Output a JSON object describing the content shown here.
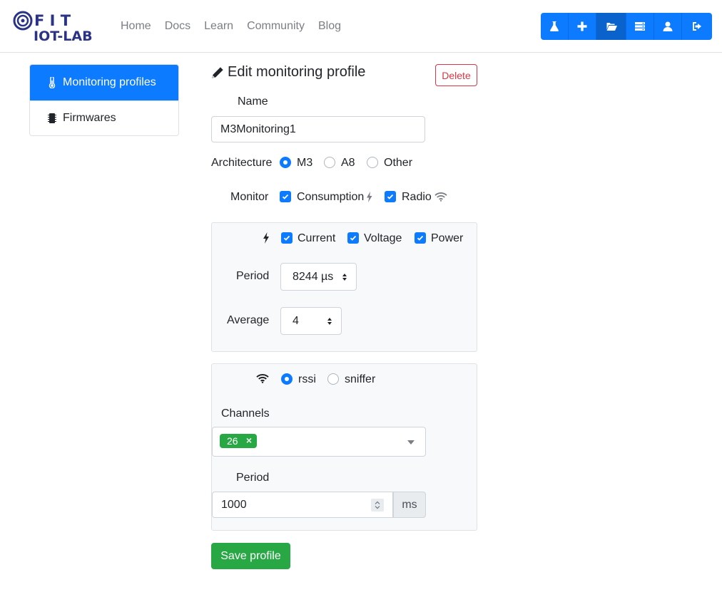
{
  "logo": {
    "line1": "F I T",
    "line2": "IOT-LAB"
  },
  "nav": [
    "Home",
    "Docs",
    "Learn",
    "Community",
    "Blog"
  ],
  "toolbar": [
    {
      "icon": "flask-icon"
    },
    {
      "icon": "plus-icon"
    },
    {
      "icon": "folder-open-icon",
      "active": true
    },
    {
      "icon": "server-icon"
    },
    {
      "icon": "user-icon"
    },
    {
      "icon": "sign-out-icon"
    }
  ],
  "sidebar": {
    "items": [
      {
        "label": "Monitoring profiles",
        "icon": "thermometer-icon",
        "active": true
      },
      {
        "label": "Firmwares",
        "icon": "microchip-icon",
        "active": false
      }
    ]
  },
  "form": {
    "title": "Edit monitoring profile",
    "delete_label": "Delete",
    "name_label": "Name",
    "name_value": "M3Monitoring1",
    "architecture_label": "Architecture",
    "architecture_options": [
      "M3",
      "A8",
      "Other"
    ],
    "architecture_selected": "M3",
    "monitor_label": "Monitor",
    "monitor_consumption": "Consumption",
    "monitor_radio": "Radio",
    "consumption": {
      "current": "Current",
      "voltage": "Voltage",
      "power": "Power",
      "period_label": "Period",
      "period_value": "8244 µs",
      "average_label": "Average",
      "average_value": "4"
    },
    "radio": {
      "mode_rssi": "rssi",
      "mode_sniffer": "sniffer",
      "mode_selected": "rssi",
      "channels_label": "Channels",
      "channels": [
        "26"
      ],
      "period_label": "Period",
      "period_value": "1000",
      "period_unit": "ms"
    },
    "save_label": "Save profile"
  },
  "colors": {
    "primary": "#0d7bff",
    "success": "#28a745",
    "danger": "#dc3545"
  }
}
